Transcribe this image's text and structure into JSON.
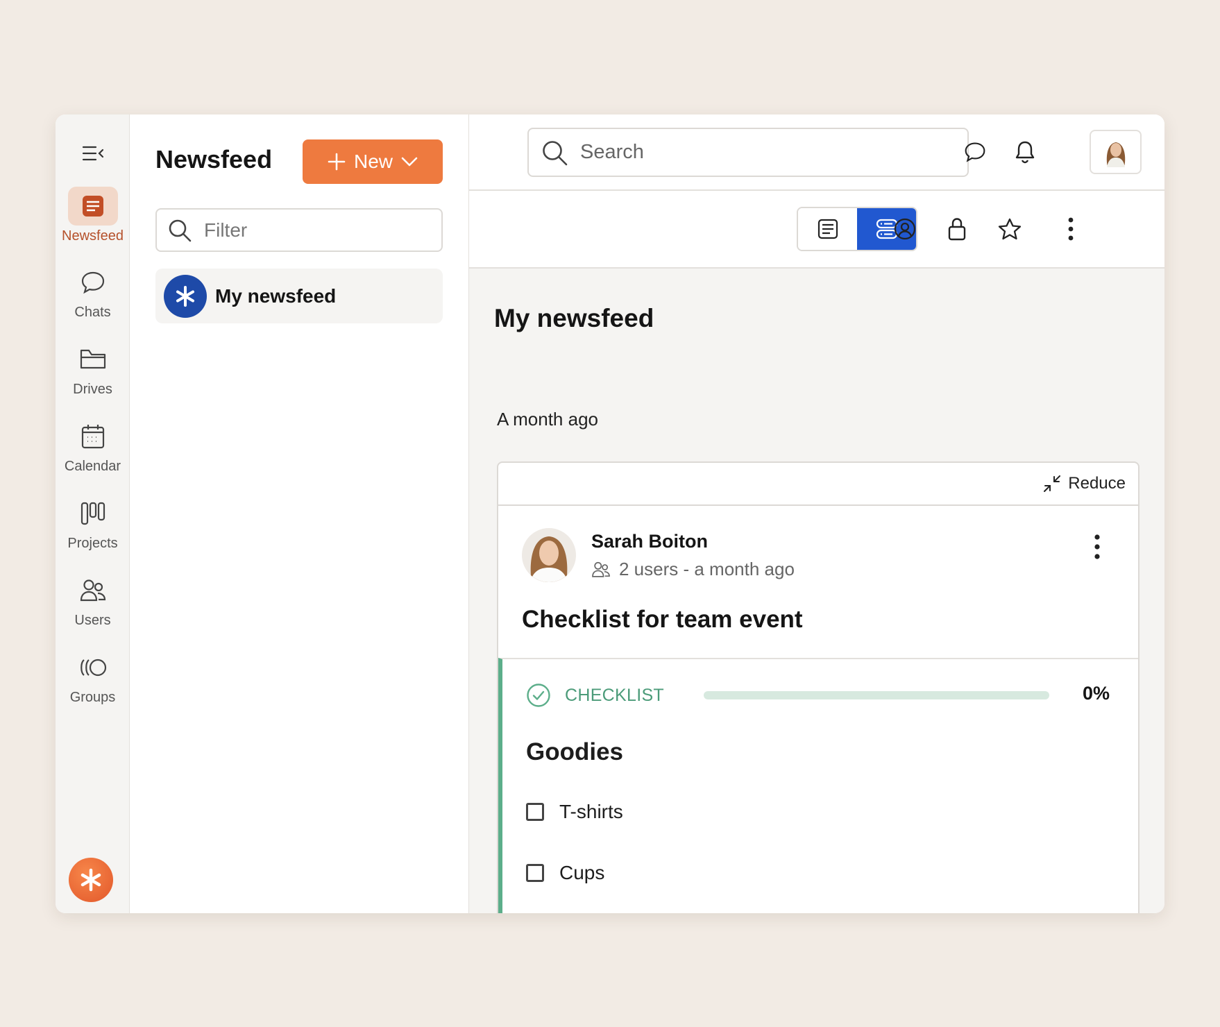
{
  "sidebar": {
    "items": [
      {
        "label": "Newsfeed",
        "icon": "newsfeed-icon",
        "active": true
      },
      {
        "label": "Chats",
        "icon": "chat-bubble-icon"
      },
      {
        "label": "Drives",
        "icon": "folder-icon"
      },
      {
        "label": "Calendar",
        "icon": "calendar-icon"
      },
      {
        "label": "Projects",
        "icon": "kanban-icon"
      },
      {
        "label": "Users",
        "icon": "users-icon"
      },
      {
        "label": "Groups",
        "icon": "groups-icon"
      }
    ]
  },
  "column": {
    "title": "Newsfeed",
    "new_label": "New",
    "filter_placeholder": "Filter",
    "feeds": [
      {
        "label": "My newsfeed"
      }
    ]
  },
  "topbar": {
    "search_placeholder": "Search"
  },
  "main": {
    "title": "My newsfeed",
    "group_date": "A month ago",
    "post": {
      "reduce_label": "Reduce",
      "author": "Sarah Boiton",
      "meta": "2 users - a month ago",
      "title": "Checklist for team event",
      "checklist": {
        "label": "CHECKLIST",
        "progress_text": "0%",
        "progress_fraction": 0,
        "title": "Goodies",
        "items": [
          {
            "label": "T-shirts",
            "checked": false
          },
          {
            "label": "Cups",
            "checked": false
          }
        ]
      }
    }
  },
  "colors": {
    "accent_orange": "#ee7a3f",
    "active_blue": "#2158d0",
    "checklist_green": "#5cae8a",
    "feed_avatar_blue": "#1e4aa8"
  }
}
